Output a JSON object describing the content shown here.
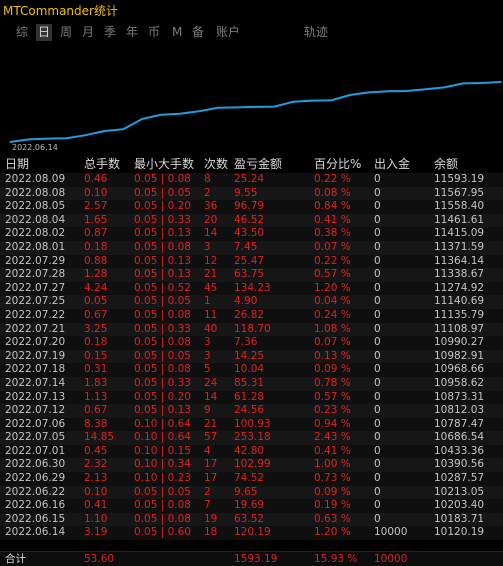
{
  "app_title": "MTCommander统计",
  "tabs": [
    "综",
    "日",
    "周",
    "月",
    "季",
    "年",
    "币",
    "M",
    "备",
    "账户",
    "轨迹"
  ],
  "active_tab": "日",
  "chart": {
    "start_date_label": "2022.06.14",
    "line_color": "#1e9fe0",
    "chart_data": {
      "type": "line",
      "x": [
        "2022.06.14",
        "2022.06.15",
        "2022.06.16",
        "2022.06.22",
        "2022.06.29",
        "2022.06.30",
        "2022.07.01",
        "2022.07.05",
        "2022.07.06",
        "2022.07.12",
        "2022.07.13",
        "2022.07.14",
        "2022.07.18",
        "2022.07.19",
        "2022.07.20",
        "2022.07.21",
        "2022.07.22",
        "2022.07.25",
        "2022.07.27",
        "2022.07.28",
        "2022.07.29",
        "2022.08.01",
        "2022.08.02",
        "2022.08.04",
        "2022.08.05",
        "2022.08.08",
        "2022.08.09"
      ],
      "values": [
        10120.19,
        10183.71,
        10203.4,
        10213.05,
        10287.57,
        10390.56,
        10433.36,
        10686.54,
        10787.47,
        10812.03,
        10873.31,
        10958.62,
        10968.66,
        10982.91,
        10990.27,
        11108.97,
        11135.79,
        11140.69,
        11274.92,
        11338.67,
        11364.14,
        11371.59,
        11415.09,
        11461.61,
        11558.4,
        11567.95,
        11593.19
      ]
    }
  },
  "columns": [
    "日期",
    "总手数",
    "最小大手数",
    "次数",
    "盈亏金额",
    "百分比%",
    "出入金",
    "余额"
  ],
  "rows": [
    {
      "date": "2022.08.09",
      "lots": "0.46",
      "minmax": "0.05 | 0.08",
      "count": "8",
      "pnl": "25.24",
      "pct": "0.22 %",
      "flow": "0",
      "balance": "11593.19"
    },
    {
      "date": "2022.08.08",
      "lots": "0.10",
      "minmax": "0.05 | 0.05",
      "count": "2",
      "pnl": "9.55",
      "pct": "0.08 %",
      "flow": "0",
      "balance": "11567.95"
    },
    {
      "date": "2022.08.05",
      "lots": "2.57",
      "minmax": "0.05 | 0.20",
      "count": "36",
      "pnl": "96.79",
      "pct": "0.84 %",
      "flow": "0",
      "balance": "11558.40"
    },
    {
      "date": "2022.08.04",
      "lots": "1.65",
      "minmax": "0.05 | 0.33",
      "count": "20",
      "pnl": "46.52",
      "pct": "0.41 %",
      "flow": "0",
      "balance": "11461.61"
    },
    {
      "date": "2022.08.02",
      "lots": "0.87",
      "minmax": "0.05 | 0.13",
      "count": "14",
      "pnl": "43.50",
      "pct": "0.38 %",
      "flow": "0",
      "balance": "11415.09"
    },
    {
      "date": "2022.08.01",
      "lots": "0.18",
      "minmax": "0.05 | 0.08",
      "count": "3",
      "pnl": "7.45",
      "pct": "0.07 %",
      "flow": "0",
      "balance": "11371.59"
    },
    {
      "date": "2022.07.29",
      "lots": "0.88",
      "minmax": "0.05 | 0.13",
      "count": "12",
      "pnl": "25.47",
      "pct": "0.22 %",
      "flow": "0",
      "balance": "11364.14"
    },
    {
      "date": "2022.07.28",
      "lots": "1.28",
      "minmax": "0.05 | 0.13",
      "count": "21",
      "pnl": "63.75",
      "pct": "0.57 %",
      "flow": "0",
      "balance": "11338.67"
    },
    {
      "date": "2022.07.27",
      "lots": "4.24",
      "minmax": "0.05 | 0.52",
      "count": "45",
      "pnl": "134.23",
      "pct": "1.20 %",
      "flow": "0",
      "balance": "11274.92"
    },
    {
      "date": "2022.07.25",
      "lots": "0.05",
      "minmax": "0.05 | 0.05",
      "count": "1",
      "pnl": "4.90",
      "pct": "0.04 %",
      "flow": "0",
      "balance": "11140.69"
    },
    {
      "date": "2022.07.22",
      "lots": "0.67",
      "minmax": "0.05 | 0.08",
      "count": "11",
      "pnl": "26.82",
      "pct": "0.24 %",
      "flow": "0",
      "balance": "11135.79"
    },
    {
      "date": "2022.07.21",
      "lots": "3.25",
      "minmax": "0.05 | 0.33",
      "count": "40",
      "pnl": "118.70",
      "pct": "1.08 %",
      "flow": "0",
      "balance": "11108.97"
    },
    {
      "date": "2022.07.20",
      "lots": "0.18",
      "minmax": "0.05 | 0.08",
      "count": "3",
      "pnl": "7.36",
      "pct": "0.07 %",
      "flow": "0",
      "balance": "10990.27"
    },
    {
      "date": "2022.07.19",
      "lots": "0.15",
      "minmax": "0.05 | 0.05",
      "count": "3",
      "pnl": "14.25",
      "pct": "0.13 %",
      "flow": "0",
      "balance": "10982.91"
    },
    {
      "date": "2022.07.18",
      "lots": "0.31",
      "minmax": "0.05 | 0.08",
      "count": "5",
      "pnl": "10.04",
      "pct": "0.09 %",
      "flow": "0",
      "balance": "10968.66"
    },
    {
      "date": "2022.07.14",
      "lots": "1.83",
      "minmax": "0.05 | 0.33",
      "count": "24",
      "pnl": "85.31",
      "pct": "0.78 %",
      "flow": "0",
      "balance": "10958.62"
    },
    {
      "date": "2022.07.13",
      "lots": "1.13",
      "minmax": "0.05 | 0.20",
      "count": "14",
      "pnl": "61.28",
      "pct": "0.57 %",
      "flow": "0",
      "balance": "10873.31"
    },
    {
      "date": "2022.07.12",
      "lots": "0.67",
      "minmax": "0.05 | 0.13",
      "count": "9",
      "pnl": "24.56",
      "pct": "0.23 %",
      "flow": "0",
      "balance": "10812.03"
    },
    {
      "date": "2022.07.06",
      "lots": "8.38",
      "minmax": "0.10 | 0.64",
      "count": "21",
      "pnl": "100.93",
      "pct": "0.94 %",
      "flow": "0",
      "balance": "10787.47"
    },
    {
      "date": "2022.07.05",
      "lots": "14.85",
      "minmax": "0.10 | 0.64",
      "count": "57",
      "pnl": "253.18",
      "pct": "2.43 %",
      "flow": "0",
      "balance": "10686.54"
    },
    {
      "date": "2022.07.01",
      "lots": "0.45",
      "minmax": "0.10 | 0.15",
      "count": "4",
      "pnl": "42.80",
      "pct": "0.41 %",
      "flow": "0",
      "balance": "10433.36"
    },
    {
      "date": "2022.06.30",
      "lots": "2.32",
      "minmax": "0.10 | 0.34",
      "count": "17",
      "pnl": "102.99",
      "pct": "1.00 %",
      "flow": "0",
      "balance": "10390.56"
    },
    {
      "date": "2022.06.29",
      "lots": "2.13",
      "minmax": "0.10 | 0.23",
      "count": "17",
      "pnl": "74.52",
      "pct": "0.73 %",
      "flow": "0",
      "balance": "10287.57"
    },
    {
      "date": "2022.06.22",
      "lots": "0.10",
      "minmax": "0.05 | 0.05",
      "count": "2",
      "pnl": "9.65",
      "pct": "0.09 %",
      "flow": "0",
      "balance": "10213.05"
    },
    {
      "date": "2022.06.16",
      "lots": "0.41",
      "minmax": "0.05 | 0.08",
      "count": "7",
      "pnl": "19.69",
      "pct": "0.19 %",
      "flow": "0",
      "balance": "10203.40"
    },
    {
      "date": "2022.06.15",
      "lots": "1.10",
      "minmax": "0.05 | 0.08",
      "count": "19",
      "pnl": "63.52",
      "pct": "0.63 %",
      "flow": "0",
      "balance": "10183.71"
    },
    {
      "date": "2022.06.14",
      "lots": "3.19",
      "minmax": "0.05 | 0.60",
      "count": "18",
      "pnl": "120.19",
      "pct": "1.20 %",
      "flow": "10000",
      "balance": "10120.19"
    }
  ],
  "totals": {
    "label": "合计",
    "lots": "53.60",
    "pnl": "1593.19",
    "pct": "15.93 %",
    "flow": "10000"
  },
  "colors": {
    "positive": "#e02020",
    "text": "#c4c4c4",
    "accent": "#f0c000"
  }
}
